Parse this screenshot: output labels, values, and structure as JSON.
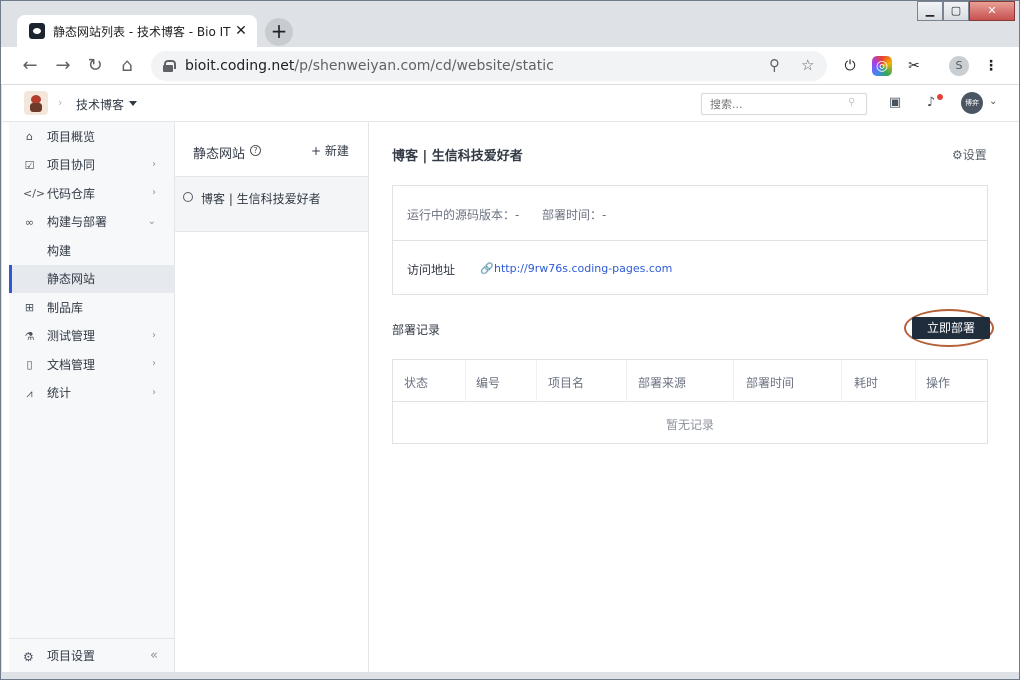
{
  "browser": {
    "tab_title": "静态网站列表 - 技术博客 - Bio IT",
    "url_host": "bioit.coding.net",
    "url_path": "/p/shenweiyan.com/cd/website/static",
    "profile_initial": "S"
  },
  "topnav": {
    "project_name": "技术博客",
    "search_placeholder": "搜索...",
    "avatar_text": "博弈"
  },
  "sidebar": {
    "items": [
      {
        "label": "项目概览",
        "icon": "home-icon"
      },
      {
        "label": "项目协同",
        "icon": "checkbox-icon"
      },
      {
        "label": "代码仓库",
        "icon": "code-icon"
      },
      {
        "label": "构建与部署",
        "icon": "infinity-icon"
      },
      {
        "label": "构建"
      },
      {
        "label": "静态网站"
      },
      {
        "label": "制品库",
        "icon": "package-icon"
      },
      {
        "label": "测试管理",
        "icon": "flask-icon"
      },
      {
        "label": "文档管理",
        "icon": "document-icon"
      },
      {
        "label": "统计",
        "icon": "chart-icon"
      }
    ],
    "footer": "项目设置"
  },
  "list": {
    "title": "静态网站",
    "new_label": "+ 新建",
    "site_name": "博客 | 生信科技爱好者"
  },
  "main": {
    "title": "博客 | 生信科技爱好者",
    "settings_label": "设置",
    "running_version_label": "运行中的源码版本：-",
    "deploy_time_label": "部署时间：-",
    "visit_label": "访问地址",
    "visit_url": "http://9rw76s.coding-pages.com",
    "records_label": "部署记录",
    "deploy_button": "立即部署",
    "table_headers": [
      "状态",
      "编号",
      "项目名",
      "部署来源",
      "部署时间",
      "耗时",
      "操作"
    ],
    "empty_text": "暂无记录"
  }
}
